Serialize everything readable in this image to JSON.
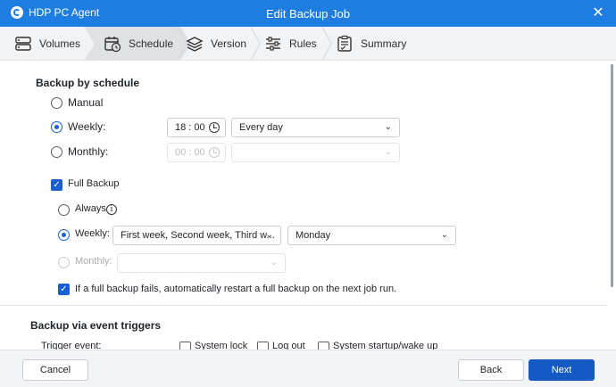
{
  "window": {
    "app_name": "HDP PC Agent",
    "title": "Edit Backup Job",
    "close_glyph": "✕"
  },
  "steps": [
    {
      "label": "Volumes",
      "icon": "volumes-icon"
    },
    {
      "label": "Schedule",
      "icon": "calendar-clock-icon",
      "active": true
    },
    {
      "label": "Version",
      "icon": "layers-icon"
    },
    {
      "label": "Rules",
      "icon": "sliders-icon"
    },
    {
      "label": "Summary",
      "icon": "clipboard-icon"
    }
  ],
  "schedule": {
    "heading": "Backup by schedule",
    "manual_label": "Manual",
    "weekly_label": "Weekly:",
    "weekly_time": "18 : 00",
    "weekly_freq": "Every day",
    "monthly_label": "Monthly:",
    "monthly_time": "00 : 00",
    "monthly_freq": ""
  },
  "full_backup": {
    "label": "Full Backup",
    "always_label": "Always",
    "weekly_label": "Weekly:",
    "weekly_weeks": "First week, Second week, Third w...",
    "weekly_day": "Monday",
    "monthly_label": "Monthly:",
    "monthly_value": "",
    "restart_label": "If a full backup fails, automatically restart a full backup on the next job run."
  },
  "events": {
    "heading": "Backup via event triggers",
    "trigger_label": "Trigger event:",
    "opt1": "System lock",
    "opt2": "Log out",
    "opt3": "System startup/wake up"
  },
  "footer": {
    "cancel": "Cancel",
    "back": "Back",
    "next": "Next"
  },
  "colors": {
    "titlebar": "#1e7de0",
    "accent": "#1a5fd0",
    "primary_button": "#1559c4"
  }
}
